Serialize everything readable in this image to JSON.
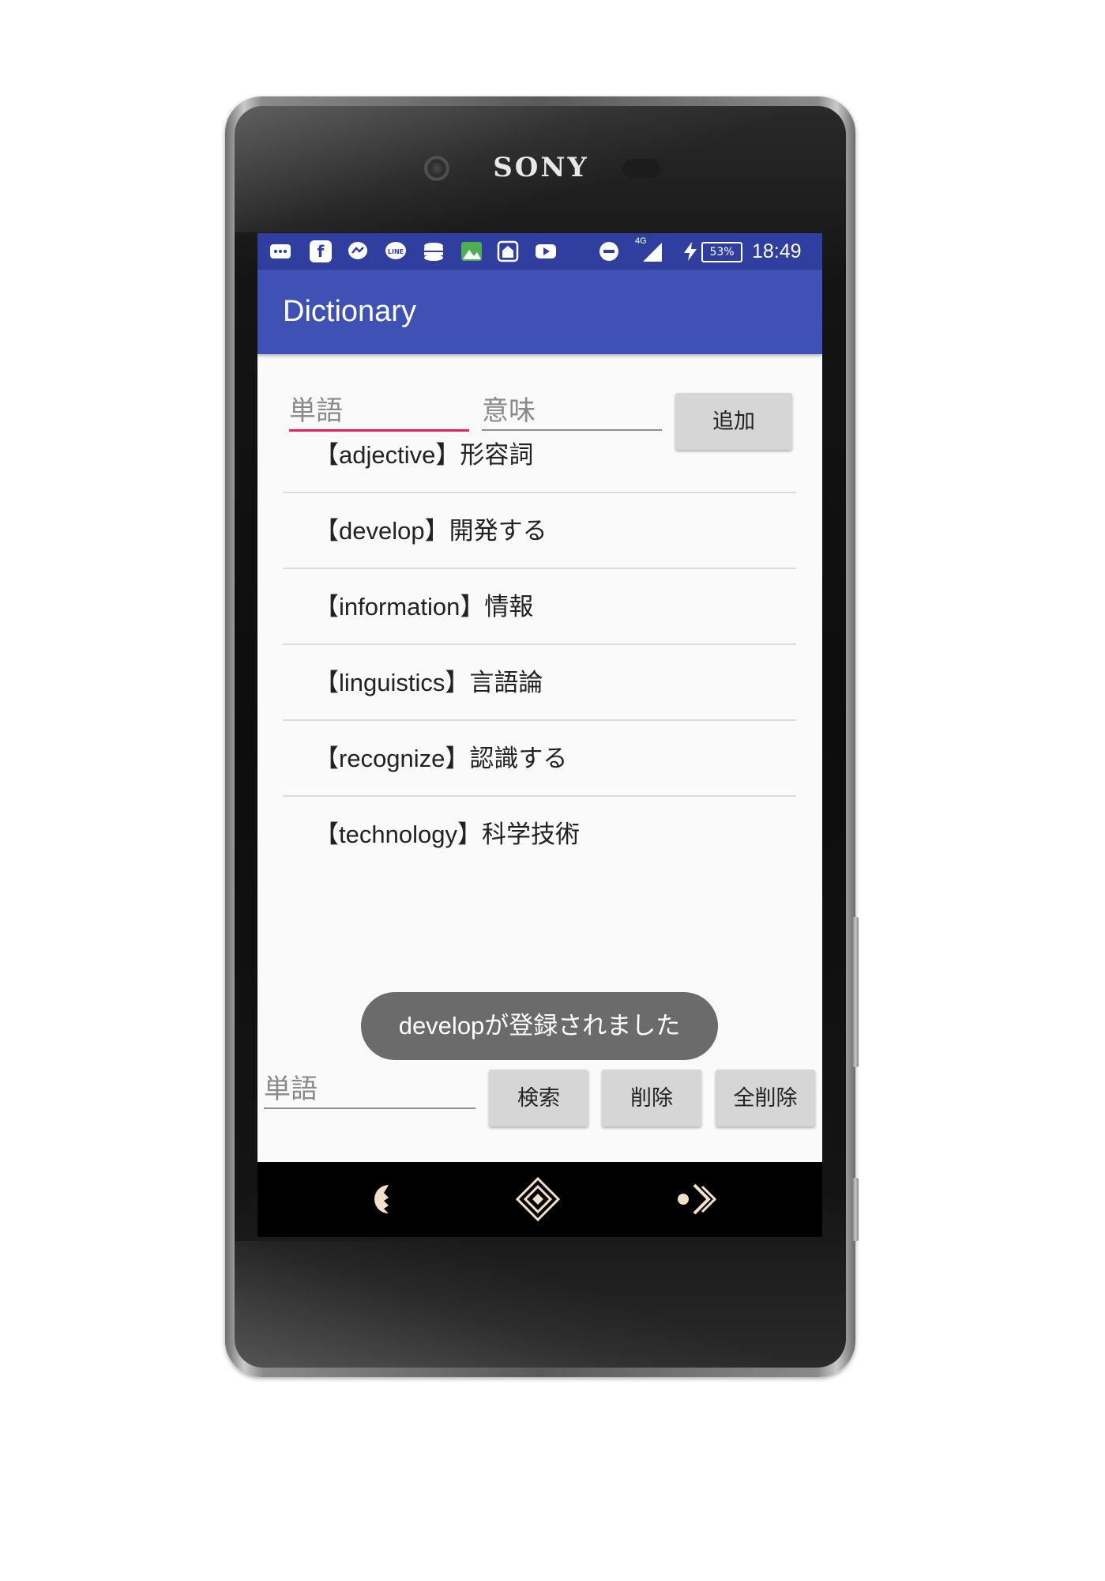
{
  "device": {
    "brand": "SONY"
  },
  "statusbar": {
    "icons": [
      "more-icon",
      "facebook-icon",
      "messenger-icon",
      "line-icon",
      "storage-icon",
      "photo-icon",
      "house-icon",
      "youtube-icon"
    ],
    "network": "4G",
    "battery": "53%",
    "time": "18:49"
  },
  "appbar": {
    "title": "Dictionary"
  },
  "add_form": {
    "word_placeholder": "単語",
    "meaning_placeholder": "意味",
    "add_label": "追加"
  },
  "entries": [
    {
      "text": "【adjective】形容詞"
    },
    {
      "text": "【develop】開発する"
    },
    {
      "text": "【information】情報"
    },
    {
      "text": "【linguistics】言語論"
    },
    {
      "text": "【recognize】認識する"
    },
    {
      "text": "【technology】科学技術"
    }
  ],
  "toast": {
    "message": "developが登録されました"
  },
  "search_form": {
    "word_placeholder": "単語",
    "search_label": "検索",
    "delete_label": "削除",
    "delete_all_label": "全削除"
  },
  "colors": {
    "statusbar": "#303f9f",
    "appbar": "#3f51b5",
    "focus_underline": "#e91e63",
    "button": "#d6d6d6",
    "toast": "#6b6b6b"
  }
}
